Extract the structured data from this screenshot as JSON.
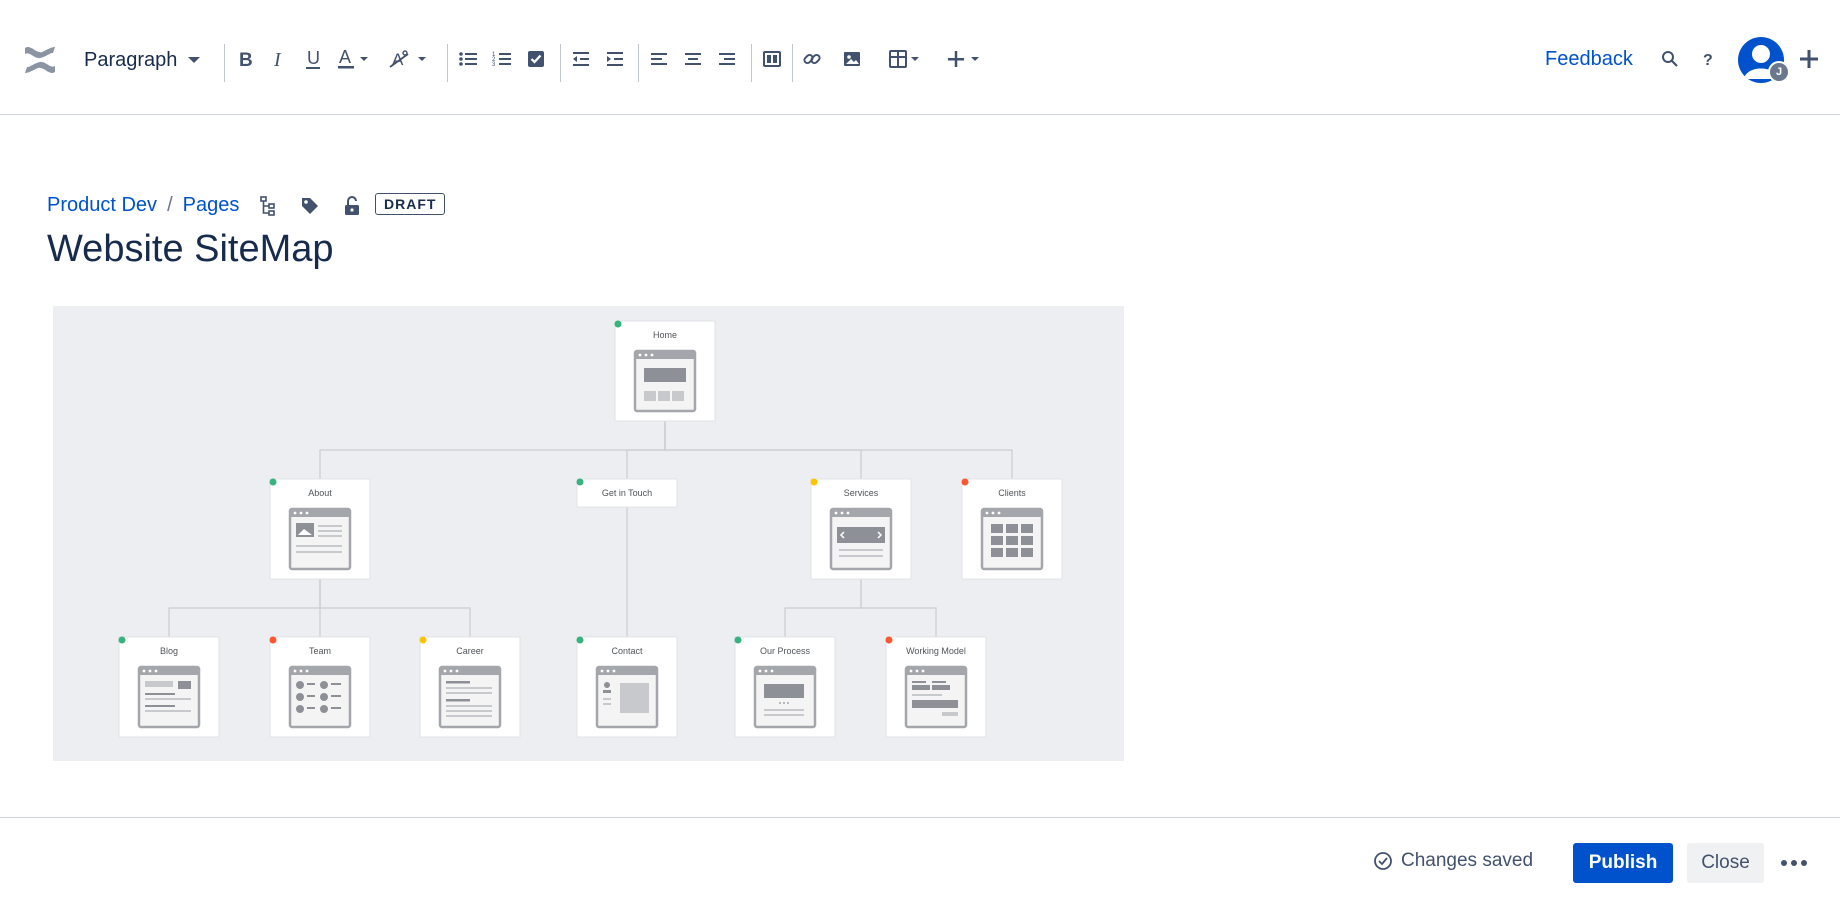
{
  "toolbar": {
    "style_select": "Paragraph",
    "feedback": "Feedback",
    "avatar_initial": "J",
    "icons": [
      "confluence-logo",
      "bold",
      "italic",
      "underline",
      "text-color",
      "clear-format",
      "bullet-list",
      "numbered-list",
      "task-list",
      "outdent",
      "indent",
      "align-left",
      "align-center",
      "align-right",
      "layouts",
      "link",
      "image",
      "table",
      "insert-more",
      "search",
      "help",
      "create"
    ]
  },
  "breadcrumb": {
    "space": "Product Dev",
    "separator": "/",
    "pages": "Pages"
  },
  "status_lozenge": "DRAFT",
  "page_title": "Website SiteMap",
  "sitemap": {
    "nodes": [
      {
        "label": "Home",
        "status": "#36B37E",
        "glyph": "home"
      },
      {
        "label": "About",
        "status": "#36B37E",
        "glyph": "about"
      },
      {
        "label": "Get in Touch",
        "status": "#36B37E",
        "glyph": "none"
      },
      {
        "label": "Services",
        "status": "#FFC400",
        "glyph": "slider"
      },
      {
        "label": "Clients",
        "status": "#FF5630",
        "glyph": "grid"
      },
      {
        "label": "Blog",
        "status": "#36B37E",
        "glyph": "blog"
      },
      {
        "label": "Team",
        "status": "#FF5630",
        "glyph": "team"
      },
      {
        "label": "Career",
        "status": "#FFC400",
        "glyph": "text"
      },
      {
        "label": "Contact",
        "status": "#36B37E",
        "glyph": "contact"
      },
      {
        "label": "Our Process",
        "status": "#36B37E",
        "glyph": "process"
      },
      {
        "label": "Working Model",
        "status": "#FF5630",
        "glyph": "model"
      }
    ],
    "edges": [
      [
        0,
        1
      ],
      [
        0,
        2
      ],
      [
        0,
        3
      ],
      [
        0,
        4
      ],
      [
        1,
        5
      ],
      [
        1,
        6
      ],
      [
        1,
        7
      ],
      [
        2,
        8
      ],
      [
        3,
        9
      ],
      [
        3,
        10
      ]
    ]
  },
  "footer": {
    "status": "Changes saved",
    "publish": "Publish",
    "close": "Close"
  },
  "colors": {
    "primary": "#0052CC",
    "text": "#172B4D",
    "icon": "#42526E",
    "canvas": "#eceef1"
  }
}
